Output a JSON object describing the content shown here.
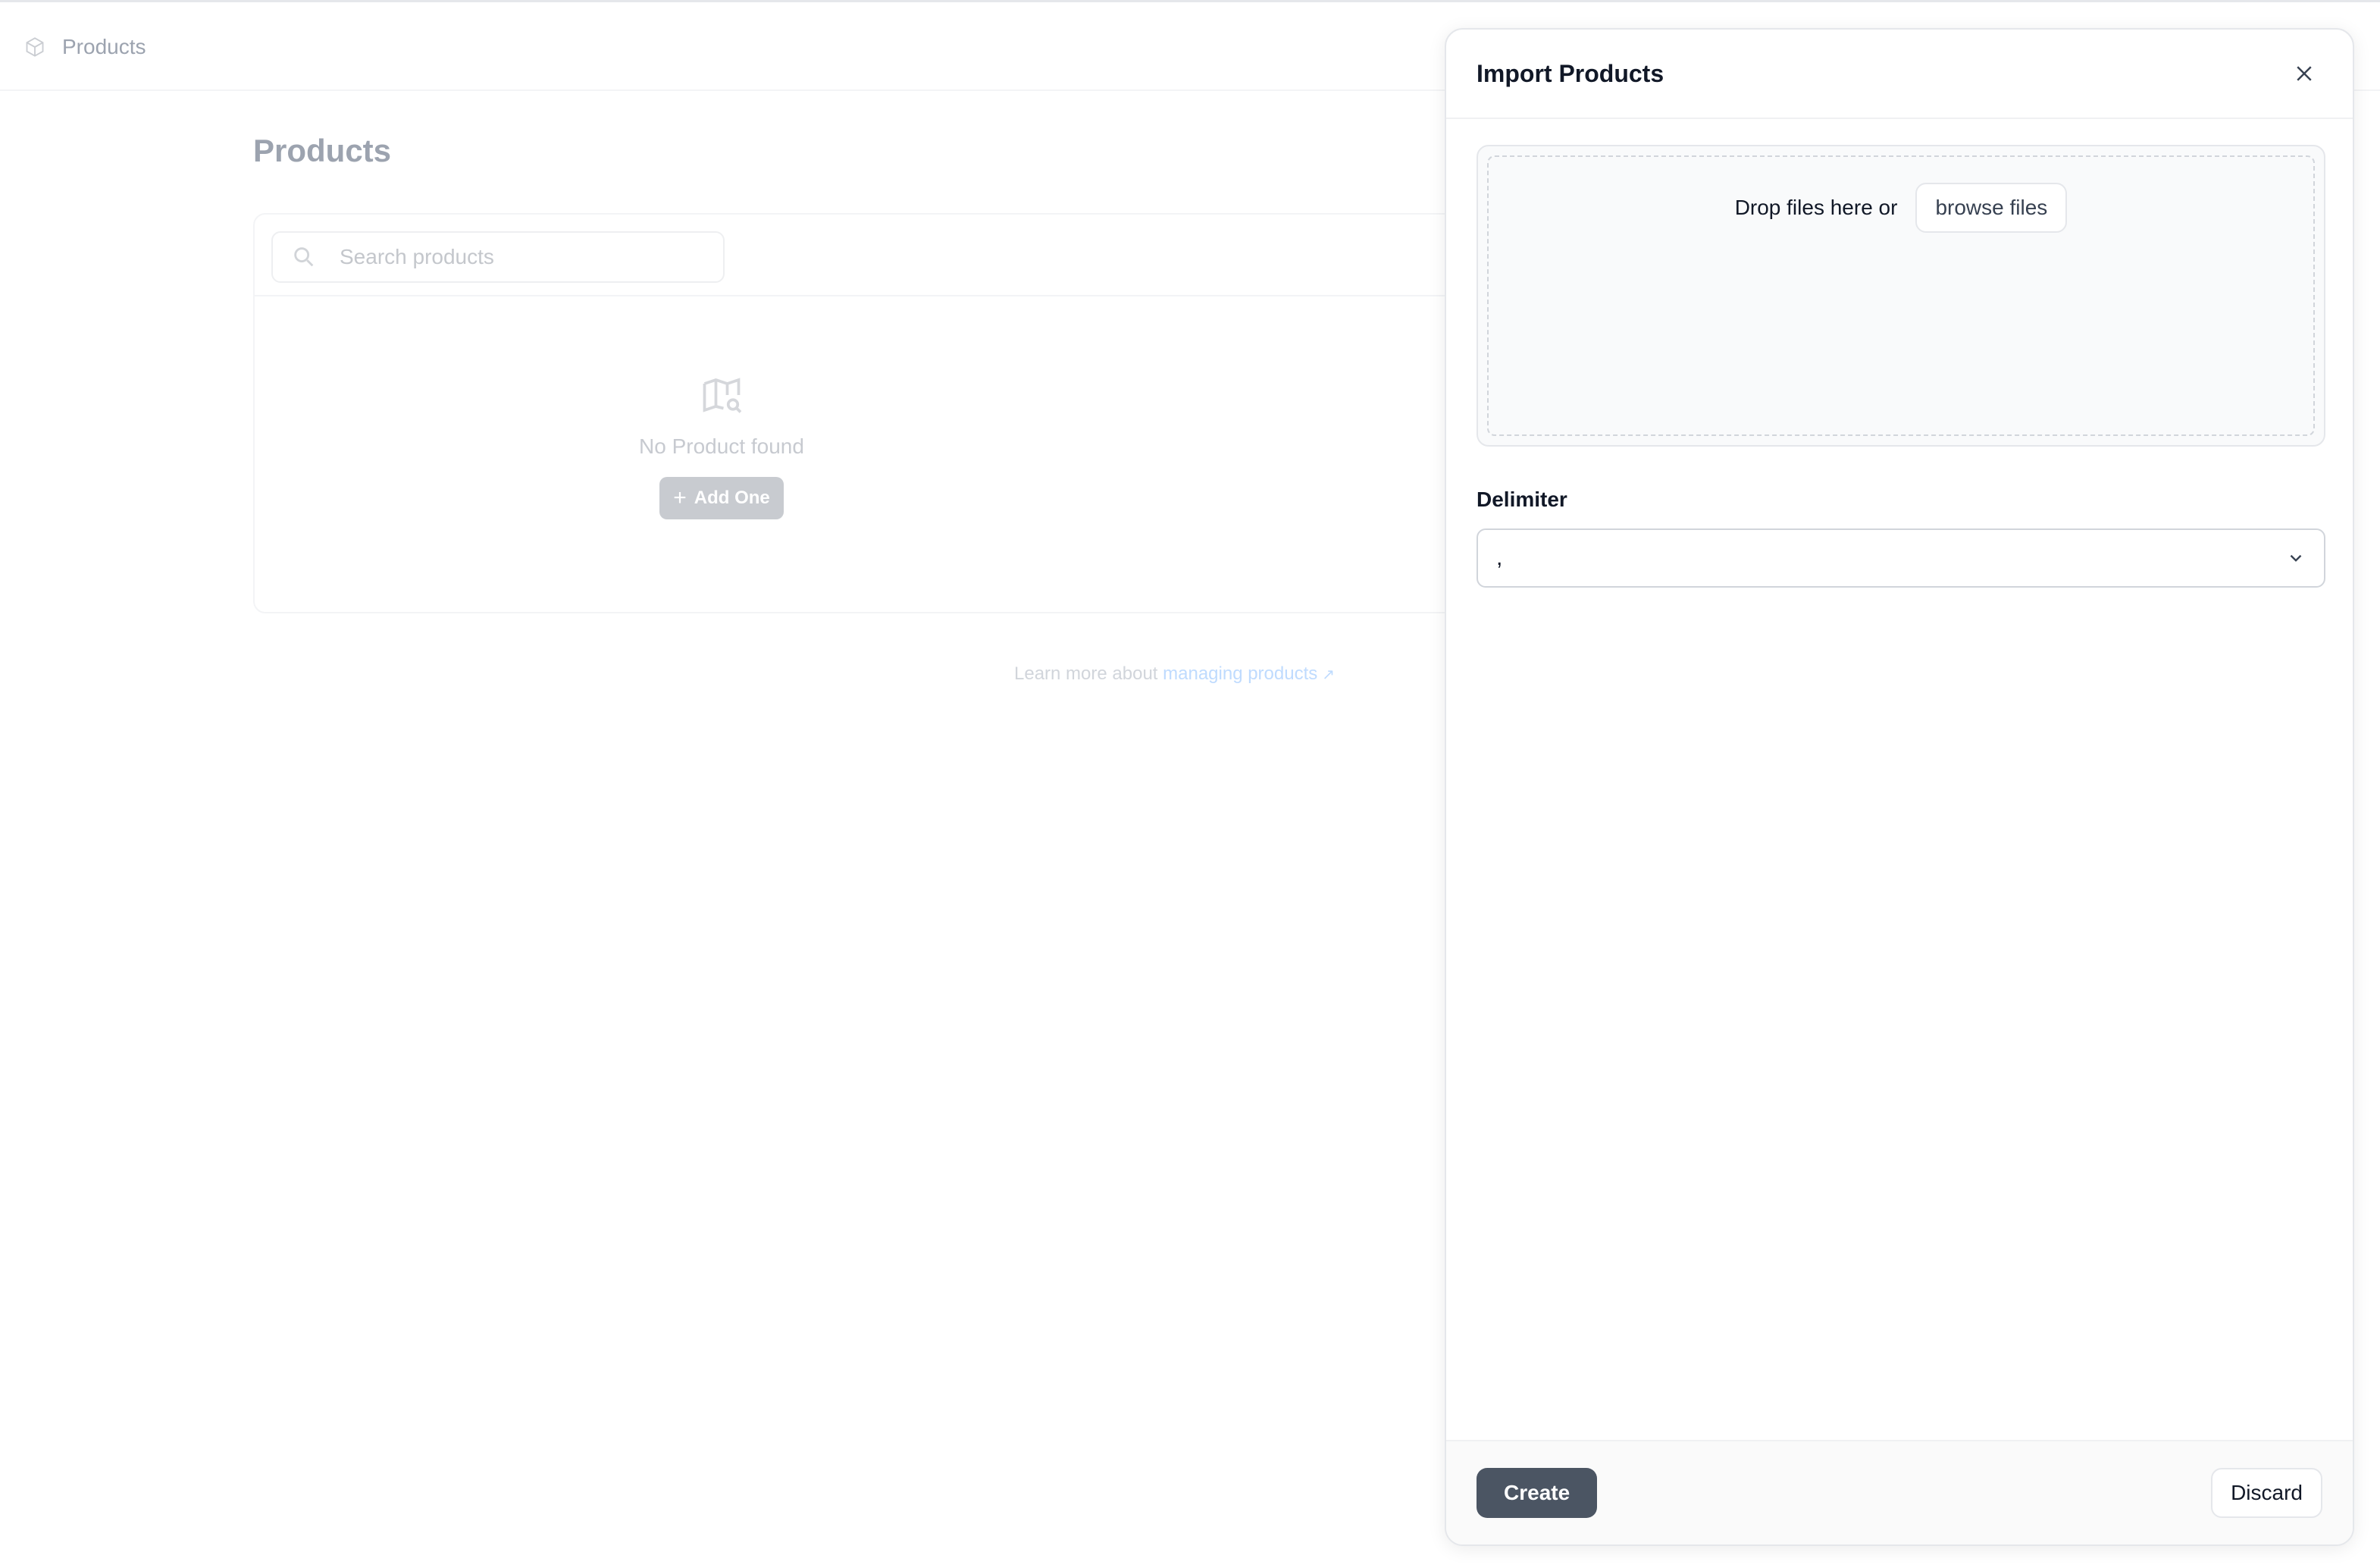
{
  "background": {
    "breadcrumb": {
      "label": "Products",
      "icon": "box-icon"
    },
    "page_title": "Products",
    "search": {
      "placeholder": "Search products"
    },
    "empty_state": {
      "icon": "map-search-icon",
      "message": "No Product found",
      "add_button": "Add One"
    },
    "learn_more": {
      "prefix": "Learn more about ",
      "link": "managing products"
    }
  },
  "drawer": {
    "title": "Import Products",
    "dropzone": {
      "text": "Drop files here or",
      "browse_label": "browse files"
    },
    "delimiter": {
      "label": "Delimiter",
      "value": ","
    },
    "footer": {
      "create_label": "Create",
      "discard_label": "Discard"
    }
  }
}
